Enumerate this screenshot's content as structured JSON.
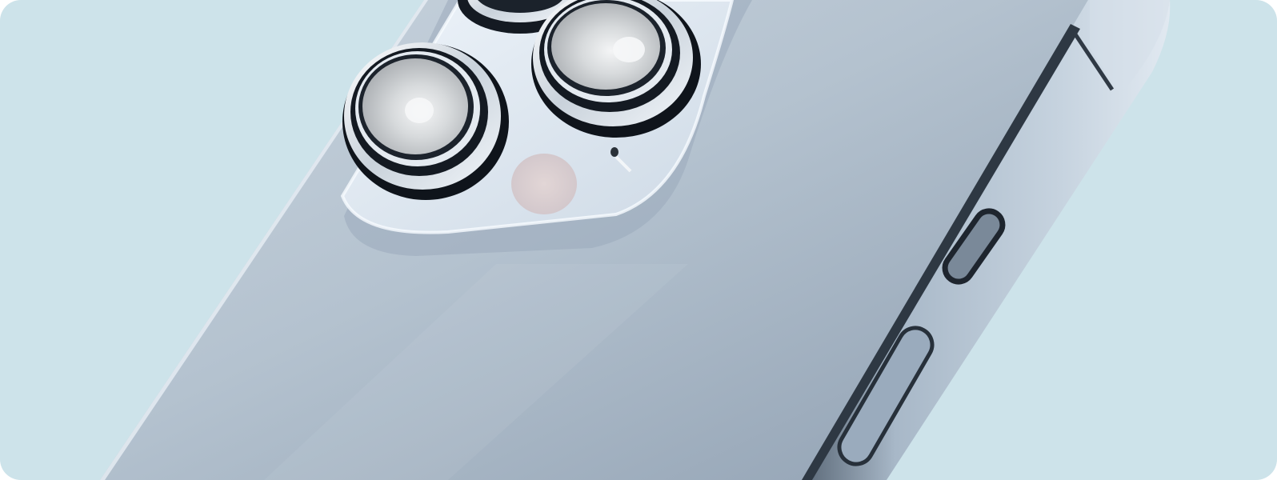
{
  "scene": {
    "subject": "smartphone-rear-camera-closeup",
    "colors": {
      "background": "#cde3ea",
      "body_light": "#c3ced9",
      "body_mid": "#aab9c8",
      "body_dark": "#8999ab",
      "frame_band": "#9fb0c2",
      "frame_shadow": "#35404c",
      "camera_plate": "#dfe9f4",
      "lens_ring_dark": "#141a22",
      "lens_ring_metal": "#e8eef5",
      "lens_glass": "#d2d6da",
      "flash": "#dccfcf"
    }
  }
}
